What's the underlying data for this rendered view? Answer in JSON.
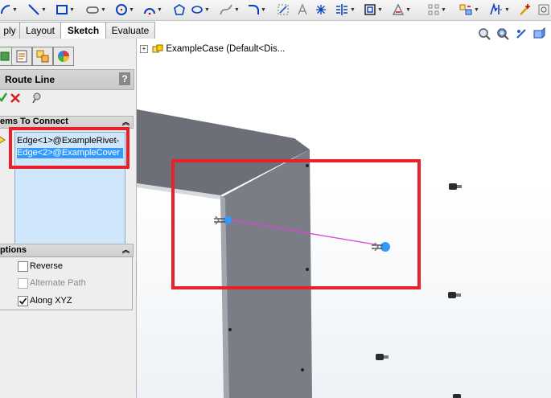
{
  "toolbar": {
    "icons": [
      "arc-tool-icon",
      "line-tool-icon",
      "rectangle-tool-icon",
      "slot-tool-icon",
      "circle-tool-icon",
      "arc-tool-icon",
      "polygon-tool-icon",
      "ellipse-tool-icon",
      "spline-tool-icon",
      "fillet-tool-icon",
      "convert-entities-icon",
      "text-tool-icon",
      "point-tool-icon",
      "mirror-entities-icon",
      "offset-entities-icon",
      "trim-entities-icon",
      "linear-pattern-icon",
      "add-relation-icon",
      "display-relations-icon",
      "repair-sketch-icon",
      "rapid-sketch-icon"
    ]
  },
  "tabs": {
    "assembly": "ply",
    "layout": "Layout",
    "sketch": "Sketch",
    "evaluate": "Evaluate"
  },
  "panel": {
    "title": "Route Line",
    "help": "?",
    "items_section": "ems To Connect",
    "items": [
      "Edge<1>@ExampleRivet-",
      "Edge<2>@ExampleCover"
    ],
    "options_section": "ptions",
    "options": [
      {
        "label": "Reverse",
        "checked": false,
        "enabled": true
      },
      {
        "label": "Alternate Path",
        "checked": false,
        "enabled": false
      },
      {
        "label": "Along XYZ",
        "checked": true,
        "enabled": true
      }
    ]
  },
  "tree": {
    "expand": "+",
    "label": "ExampleCase  (Default<Dis..."
  },
  "colors": {
    "highlight": "#e8202a",
    "selection": "#3399ff",
    "route_line": "#e040e0"
  }
}
